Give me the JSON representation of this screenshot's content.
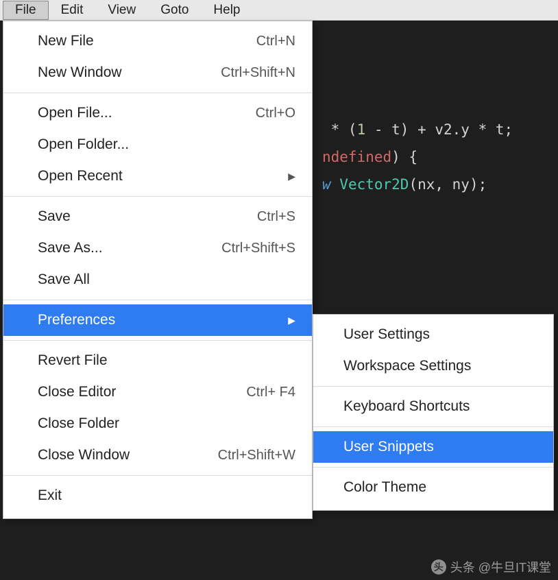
{
  "menubar": {
    "items": [
      "File",
      "Edit",
      "View",
      "Goto",
      "Help"
    ],
    "active": "File"
  },
  "file_menu": {
    "groups": [
      [
        {
          "label": "New File",
          "shortcut": "Ctrl+N"
        },
        {
          "label": "New Window",
          "shortcut": "Ctrl+Shift+N"
        }
      ],
      [
        {
          "label": "Open File...",
          "shortcut": "Ctrl+O"
        },
        {
          "label": "Open Folder..."
        },
        {
          "label": "Open Recent",
          "submenu": true
        }
      ],
      [
        {
          "label": "Save",
          "shortcut": "Ctrl+S"
        },
        {
          "label": "Save As...",
          "shortcut": "Ctrl+Shift+S"
        },
        {
          "label": "Save All"
        }
      ],
      [
        {
          "label": "Preferences",
          "submenu": true,
          "selected": true
        }
      ],
      [
        {
          "label": "Revert File"
        },
        {
          "label": "Close Editor",
          "shortcut": "Ctrl+  F4"
        },
        {
          "label": "Close Folder"
        },
        {
          "label": "Close Window",
          "shortcut": "Ctrl+Shift+W"
        }
      ],
      [
        {
          "label": "Exit"
        }
      ]
    ]
  },
  "preferences_submenu": {
    "groups": [
      [
        {
          "label": "User Settings"
        },
        {
          "label": "Workspace Settings"
        }
      ],
      [
        {
          "label": "Keyboard Shortcuts"
        }
      ],
      [
        {
          "label": "User Snippets",
          "selected": true
        }
      ],
      [
        {
          "label": "Color Theme"
        }
      ]
    ]
  },
  "code": {
    "line1": {
      "pre": " * (",
      "n1": "1",
      "mid": " - t) + v2.y * t;"
    },
    "line2": {
      "kw": "ndefined",
      "tail": ") {"
    },
    "line3": {
      "new": "w",
      "type": " Vector2D",
      "args": "(nx, ny);"
    }
  },
  "watermark": {
    "text": "头条 @牛旦IT课堂",
    "icon": "头"
  }
}
